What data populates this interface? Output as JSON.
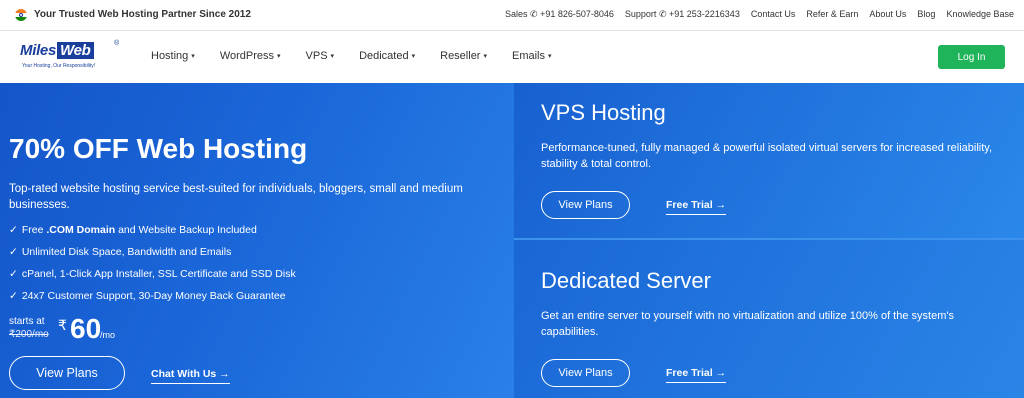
{
  "topbar": {
    "tagline": "Your Trusted Web Hosting Partner Since 2012",
    "sales": "Sales",
    "sales_phone": "+91 826-507-8046",
    "support": "Support",
    "support_phone": "+91 253-2216343",
    "links": [
      "Contact Us",
      "Refer & Earn",
      "About Us",
      "Blog",
      "Knowledge Base"
    ]
  },
  "nav": {
    "logo_text_1": "Miles",
    "logo_text_2": "Web",
    "logo_reg": "®",
    "logo_sub": "Your Hosting, Our Responsibility!",
    "items": [
      "Hosting",
      "WordPress",
      "VPS",
      "Dedicated",
      "Reseller",
      "Emails"
    ],
    "login": "Log In"
  },
  "hero": {
    "title": "70% OFF Web Hosting",
    "description": "Top-rated website hosting service best-suited for individuals, bloggers, small and medium businesses.",
    "features": [
      {
        "pre": "Free ",
        "bold": ".COM Domain",
        "post": " and Website Backup Included"
      },
      {
        "pre": "Unlimited Disk Space, Bandwidth and Emails",
        "bold": "",
        "post": ""
      },
      {
        "pre": "cPanel, 1-Click App Installer, SSL Certificate and SSD Disk",
        "bold": "",
        "post": ""
      },
      {
        "pre": "24x7 Customer Support, 30-Day Money Back Guarantee",
        "bold": "",
        "post": ""
      }
    ],
    "check": "✓",
    "starts_at": "starts at",
    "old_price": "₹200/mo",
    "currency": "₹",
    "price": "60",
    "per": "/mo",
    "view_plans": "View Plans",
    "chat": "Chat With Us →"
  },
  "vps": {
    "title": "VPS Hosting",
    "description": "Performance-tuned, fully managed & powerful isolated virtual servers for increased reliability, stability & total control.",
    "view_plans": "View Plans",
    "free_trial": "Free Trial →"
  },
  "dedicated": {
    "title": "Dedicated Server",
    "description": "Get an entire server to yourself with no virtualization and utilize 100% of the system's capabilities.",
    "view_plans": "View Plans",
    "free_trial": "Free Trial →"
  },
  "colors": {
    "brand_blue": "#1a3e9c",
    "hero_blue": "#1a66d8",
    "login_green": "#1fb35a"
  }
}
